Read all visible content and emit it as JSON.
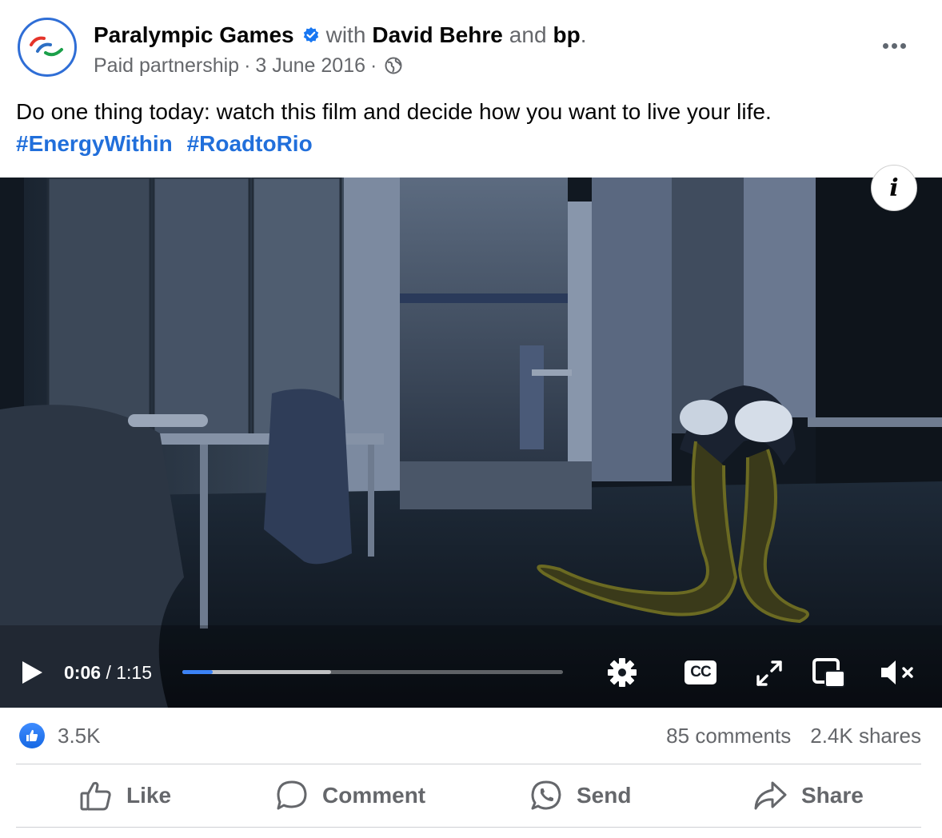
{
  "post": {
    "author": "Paralympic Games",
    "with_label": "with",
    "partner1": "David Behre",
    "and_label": "and",
    "partner2": "bp",
    "partner2_suffix": ".",
    "subline": {
      "paid": "Paid partnership",
      "separator": "·",
      "date": "3 June 2016",
      "separator2": "·",
      "privacy_icon": "globe-icon"
    },
    "message": "Do one thing today: watch this film and decide how you want to live your life.",
    "hashtags": [
      "#EnergyWithin",
      "#RoadtoRio"
    ]
  },
  "video": {
    "info_label": "i",
    "current_time": "0:06",
    "time_separator": "/",
    "duration": "1:15",
    "progress_fraction": 0.08,
    "buffered_fraction": 0.39,
    "cc_label": "CC",
    "icons": [
      "play-icon",
      "settings-gear-icon",
      "captions-icon",
      "fullscreen-icon",
      "picture-in-picture-icon",
      "muted-speaker-icon"
    ]
  },
  "stats": {
    "reactions_count": "3.5K",
    "comments": "85 comments",
    "shares": "2.4K shares"
  },
  "actions": {
    "like": "Like",
    "comment": "Comment",
    "send": "Send",
    "share": "Share"
  },
  "colors": {
    "accent_blue": "#216fdb",
    "muted_text": "#65676b",
    "progress_blue": "#3b82f6"
  }
}
